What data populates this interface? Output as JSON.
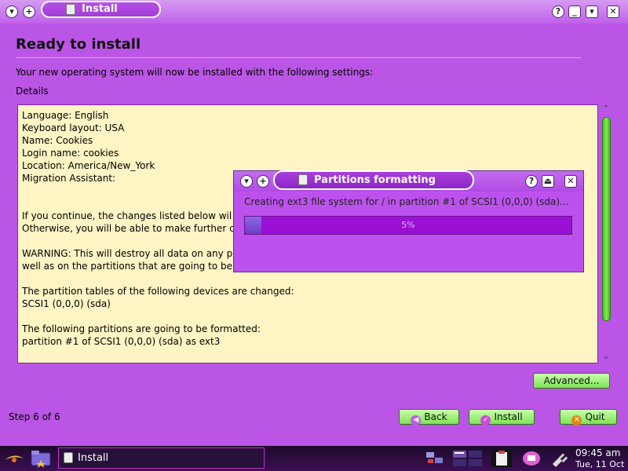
{
  "window": {
    "title": "Install"
  },
  "page": {
    "heading": "Ready to install",
    "intro": "Your new operating system will now be installed with the following settings:",
    "details_label": "Details",
    "details_lines": [
      "Language: English",
      "Keyboard layout: USA",
      "Name: Cookies",
      "Login name: cookies",
      "Location: America/New_York",
      "Migration Assistant:",
      "",
      "",
      "If you continue, the changes listed below wil",
      "Otherwise, you will be able to make further c",
      "",
      "WARNING: This will destroy all data on any pa",
      "well as on the partitions that are going to be formatted.",
      "",
      "The partition tables of the following devices are changed:",
      "SCSI1 (0,0,0) (sda)",
      "",
      "The following partitions are going to be formatted:",
      "partition #1 of SCSI1 (0,0,0) (sda) as ext3"
    ],
    "step_text": "Step 6 of 6"
  },
  "buttons": {
    "advanced": "Advanced...",
    "back": "Back",
    "install": "Install",
    "quit": "Quit"
  },
  "dialog": {
    "title": "Partitions formatting",
    "message": "Creating ext3 file system for / in partition #1 of SCSI1 (0,0,0) (sda)...",
    "progress_percent": 5,
    "progress_label": "5%"
  },
  "taskbar": {
    "task_label": "Install",
    "clock_time": "09:45 am",
    "clock_date": "Tue, 11 Oct"
  },
  "colors": {
    "window_bg": "#bb55e6",
    "details_bg": "#fff4c4",
    "accent_green": "#7ee356",
    "progress_track": "#9a10d4"
  }
}
